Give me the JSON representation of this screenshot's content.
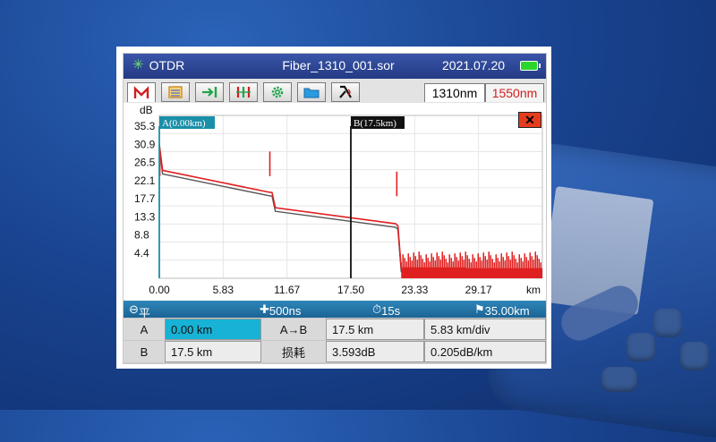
{
  "titlebar": {
    "app_name": "OTDR",
    "file_name": "Fiber_1310_001.sor",
    "date": "2021.07.20"
  },
  "toolbar": {
    "tools": [
      {
        "name": "trace-tool",
        "glyph": "M"
      },
      {
        "name": "event-list-tool",
        "glyph": "▤"
      },
      {
        "name": "marker-tool",
        "glyph": "→|"
      },
      {
        "name": "cursor-tool",
        "glyph": "┃┃┃"
      },
      {
        "name": "settings-tool",
        "glyph": "⚙"
      },
      {
        "name": "folder-tool",
        "glyph": "▬"
      },
      {
        "name": "wavelength-tool",
        "glyph": "λ"
      }
    ],
    "wavelengths": [
      "1310nm",
      "1550nm"
    ],
    "selected_wavelength": "1310nm"
  },
  "close_button": {
    "label": "✕"
  },
  "chart_data": {
    "type": "line",
    "ylabel": "dB",
    "xlabel": "km",
    "y_ticks": [
      "35.3",
      "30.9",
      "26.5",
      "22.1",
      "17.7",
      "13.3",
      "8.8",
      "4.4"
    ],
    "x_ticks": [
      "0.00",
      "5.83",
      "11.67",
      "17.50",
      "23.33",
      "29.17"
    ],
    "xlim": [
      0,
      35.0
    ],
    "ylim": [
      0,
      39.7
    ],
    "grid": true,
    "series": [
      {
        "color": "#e02020",
        "x": [
          0,
          0.3,
          10.0,
          10.3,
          10.6,
          21.6,
          21.8,
          22.1,
          28.0
        ],
        "y": [
          32.7,
          26.3,
          21.0,
          20.9,
          17.2,
          13.3,
          12.8,
          2.5,
          2.5
        ]
      }
    ],
    "cursors": [
      {
        "label": "A(0.00km)",
        "x": 0.0
      },
      {
        "label": "B(17.5km)",
        "x": 17.5
      }
    ]
  },
  "status": {
    "mode": "平均",
    "pulse": "500ns",
    "duration": "15s",
    "range": "35.00km"
  },
  "table": {
    "row1": {
      "label": "A",
      "value": "0.00 km",
      "label2": "A→B",
      "value2": "17.5 km",
      "value3": "5.83 km/div"
    },
    "row2": {
      "label": "B",
      "value": "17.5 km",
      "label2": "损耗",
      "value2": "3.593dB",
      "value3": "0.205dB/km"
    }
  },
  "colors": {
    "accent": "#17b2d5",
    "trace": "#e02020",
    "titlebar": "#2b4596",
    "statusbar": "#2277aa"
  }
}
